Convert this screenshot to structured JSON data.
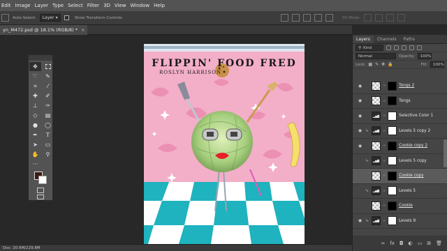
{
  "menu": [
    "Edit",
    "Image",
    "Layer",
    "Type",
    "Select",
    "Filter",
    "3D",
    "View",
    "Window",
    "Help"
  ],
  "options": {
    "auto_select_label": "Auto-Select:",
    "auto_select_value": "Layer",
    "show_transform_label": "Show Transform Controls",
    "mode_3d": "3D Mode:"
  },
  "document_tab": {
    "title": "yn_M472.psd @ 18.1% (RGB/8) *",
    "close": "×"
  },
  "artwork": {
    "title": "FLIPPIN' FOOD FRED",
    "subtitle": "ROSLYN HARRISON"
  },
  "status": {
    "doc": "Doc: 20.6M/229.8M"
  },
  "panel": {
    "tabs": [
      "Layers",
      "Channels",
      "Paths"
    ],
    "kind_label": "Kind",
    "blend_mode": "Normal",
    "opacity_label": "Opacity:",
    "opacity_value": "100%",
    "lock_label": "Lock:",
    "fill_label": "Fill:",
    "fill_value": "100%"
  },
  "layers": [
    {
      "name": "Tongs 2",
      "thumb": "pixel",
      "mask": "black",
      "visible": true,
      "clipped": false,
      "underline": true
    },
    {
      "name": "Tongs",
      "thumb": "pixel",
      "mask": "black",
      "visible": true,
      "clipped": false,
      "underline": false
    },
    {
      "name": "Selective Color 1",
      "thumb": "adjust",
      "mask": "white",
      "visible": true,
      "clipped": false,
      "underline": false
    },
    {
      "name": "Levels 5 copy 2",
      "thumb": "adjust",
      "mask": "white",
      "visible": true,
      "clipped": true,
      "underline": false
    },
    {
      "name": "Cookie copy 2",
      "thumb": "pixel",
      "mask": "black",
      "visible": true,
      "clipped": false,
      "underline": true
    },
    {
      "name": "Levels 5 copy",
      "thumb": "adjust",
      "mask": "white",
      "visible": false,
      "clipped": true,
      "underline": false
    },
    {
      "name": "Cookie copy",
      "thumb": "pixel",
      "mask": "black",
      "visible": false,
      "clipped": false,
      "underline": true,
      "selected": true
    },
    {
      "name": "Levels 5",
      "thumb": "adjust",
      "mask": "white",
      "visible": false,
      "clipped": true,
      "underline": false
    },
    {
      "name": "Cookie",
      "thumb": "pixel",
      "mask": "black",
      "visible": false,
      "clipped": false,
      "underline": true
    },
    {
      "name": "Levels 9",
      "thumb": "adjust",
      "mask": "white",
      "visible": true,
      "clipped": true,
      "underline": false
    }
  ],
  "icons": {
    "eye": "eye-icon",
    "chain": "link-icon",
    "footer": [
      "link-icon",
      "fx-icon",
      "mask-icon",
      "adjustment-icon",
      "folder-icon",
      "new-layer-icon",
      "trash-icon"
    ]
  },
  "colors": {
    "foreground": "#3a1a10",
    "background": "#ffffff",
    "canvas_pink": "#f3aec8",
    "floor_teal": "#1fb2bf"
  }
}
